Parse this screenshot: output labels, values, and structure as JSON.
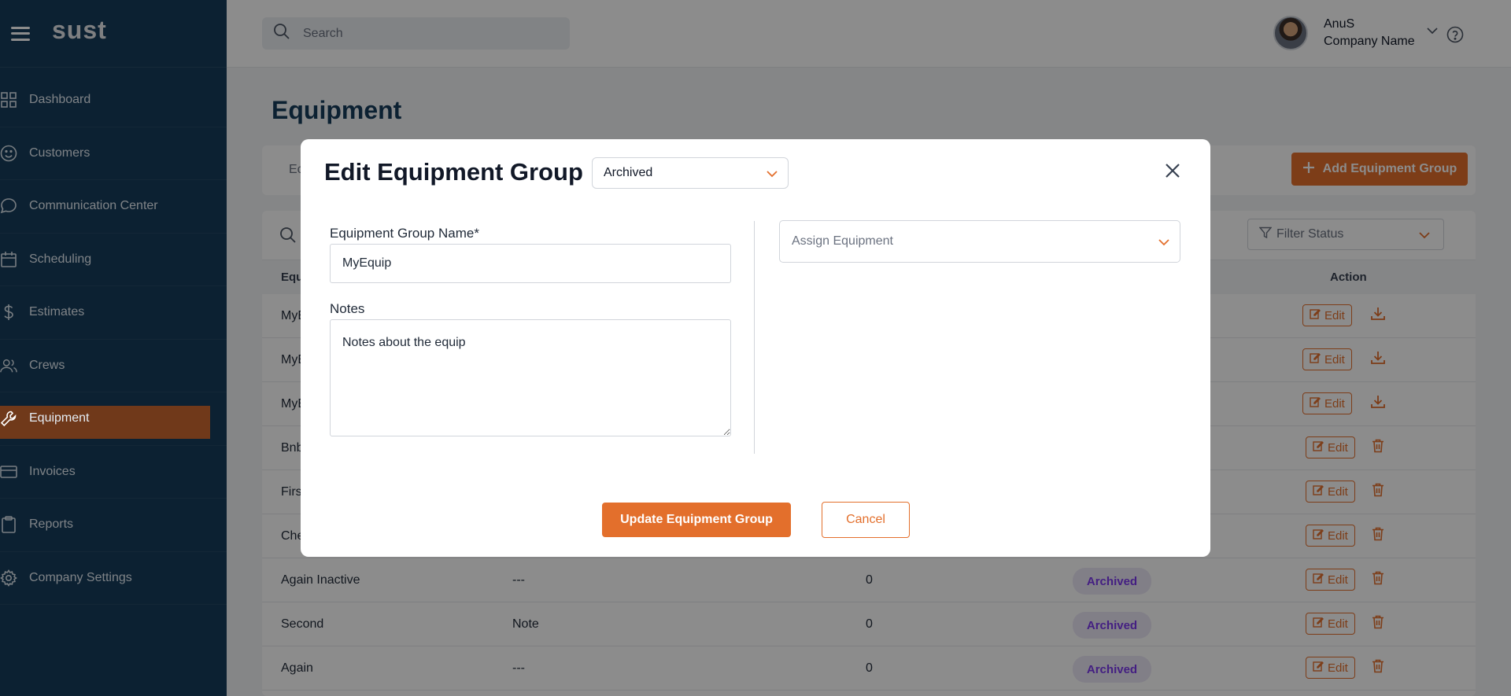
{
  "app": {
    "logo": "sust"
  },
  "sidebar": {
    "items": [
      {
        "label": "Dashboard",
        "icon": "grid-icon",
        "active": false
      },
      {
        "label": "Customers",
        "icon": "smile-icon",
        "active": false
      },
      {
        "label": "Communication Center",
        "icon": "chat-icon",
        "active": false
      },
      {
        "label": "Scheduling",
        "icon": "calendar-icon",
        "active": false
      },
      {
        "label": "Estimates",
        "icon": "dollar-icon",
        "active": false
      },
      {
        "label": "Crews",
        "icon": "users-icon",
        "active": false
      },
      {
        "label": "Equipment",
        "icon": "wrench-icon",
        "active": true
      },
      {
        "label": "Invoices",
        "icon": "card-icon",
        "active": false
      },
      {
        "label": "Reports",
        "icon": "clipboard-icon",
        "active": false
      },
      {
        "label": "Company Settings",
        "icon": "gear-icon",
        "active": false
      }
    ]
  },
  "header": {
    "search_placeholder": "Search",
    "user_name": "AnuS",
    "company_name": "Company Name"
  },
  "page": {
    "title": "Equipment",
    "tab_partial": "Ec",
    "add_button": "Add Equipment Group",
    "filter_placeholder": "Filter Status"
  },
  "table": {
    "headers": {
      "name_partial": "Equ",
      "action": "Action"
    },
    "rows": [
      {
        "name": "MyE",
        "notes": "",
        "count": "",
        "status": "",
        "actions": [
          "edit",
          "download"
        ]
      },
      {
        "name": "MyE",
        "notes": "",
        "count": "",
        "status": "",
        "actions": [
          "edit",
          "download"
        ]
      },
      {
        "name": "MyE",
        "notes": "",
        "count": "",
        "status": "",
        "actions": [
          "edit",
          "download"
        ]
      },
      {
        "name": "Bnb",
        "notes": "",
        "count": "",
        "status": "",
        "actions": [
          "edit",
          "delete"
        ]
      },
      {
        "name": "Firs",
        "notes": "",
        "count": "",
        "status": "",
        "actions": [
          "edit",
          "delete"
        ]
      },
      {
        "name": "Che",
        "notes": "",
        "count": "",
        "status": "",
        "actions": [
          "edit",
          "delete"
        ]
      },
      {
        "name": "Again Inactive",
        "notes": "---",
        "count": "0",
        "status": "Archived",
        "actions": [
          "edit",
          "delete"
        ]
      },
      {
        "name": "Second",
        "notes": "Note",
        "count": "0",
        "status": "Archived",
        "actions": [
          "edit",
          "delete"
        ]
      },
      {
        "name": "Again",
        "notes": "---",
        "count": "0",
        "status": "Archived",
        "actions": [
          "edit",
          "delete"
        ]
      }
    ],
    "edit_label": "Edit"
  },
  "modal": {
    "title": "Edit Equipment Group",
    "status_value": "Archived",
    "name_label": "Equipment Group Name*",
    "name_value": "MyEquip",
    "notes_label": "Notes",
    "notes_value": "Notes about the equip",
    "assign_placeholder": "Assign Equipment",
    "update_button": "Update Equipment Group",
    "cancel_button": "Cancel"
  },
  "colors": {
    "sidebar_bg": "#163d5c",
    "accent": "#e36f2c",
    "badge_bg": "#ece8f6",
    "badge_text": "#7c3aed"
  }
}
